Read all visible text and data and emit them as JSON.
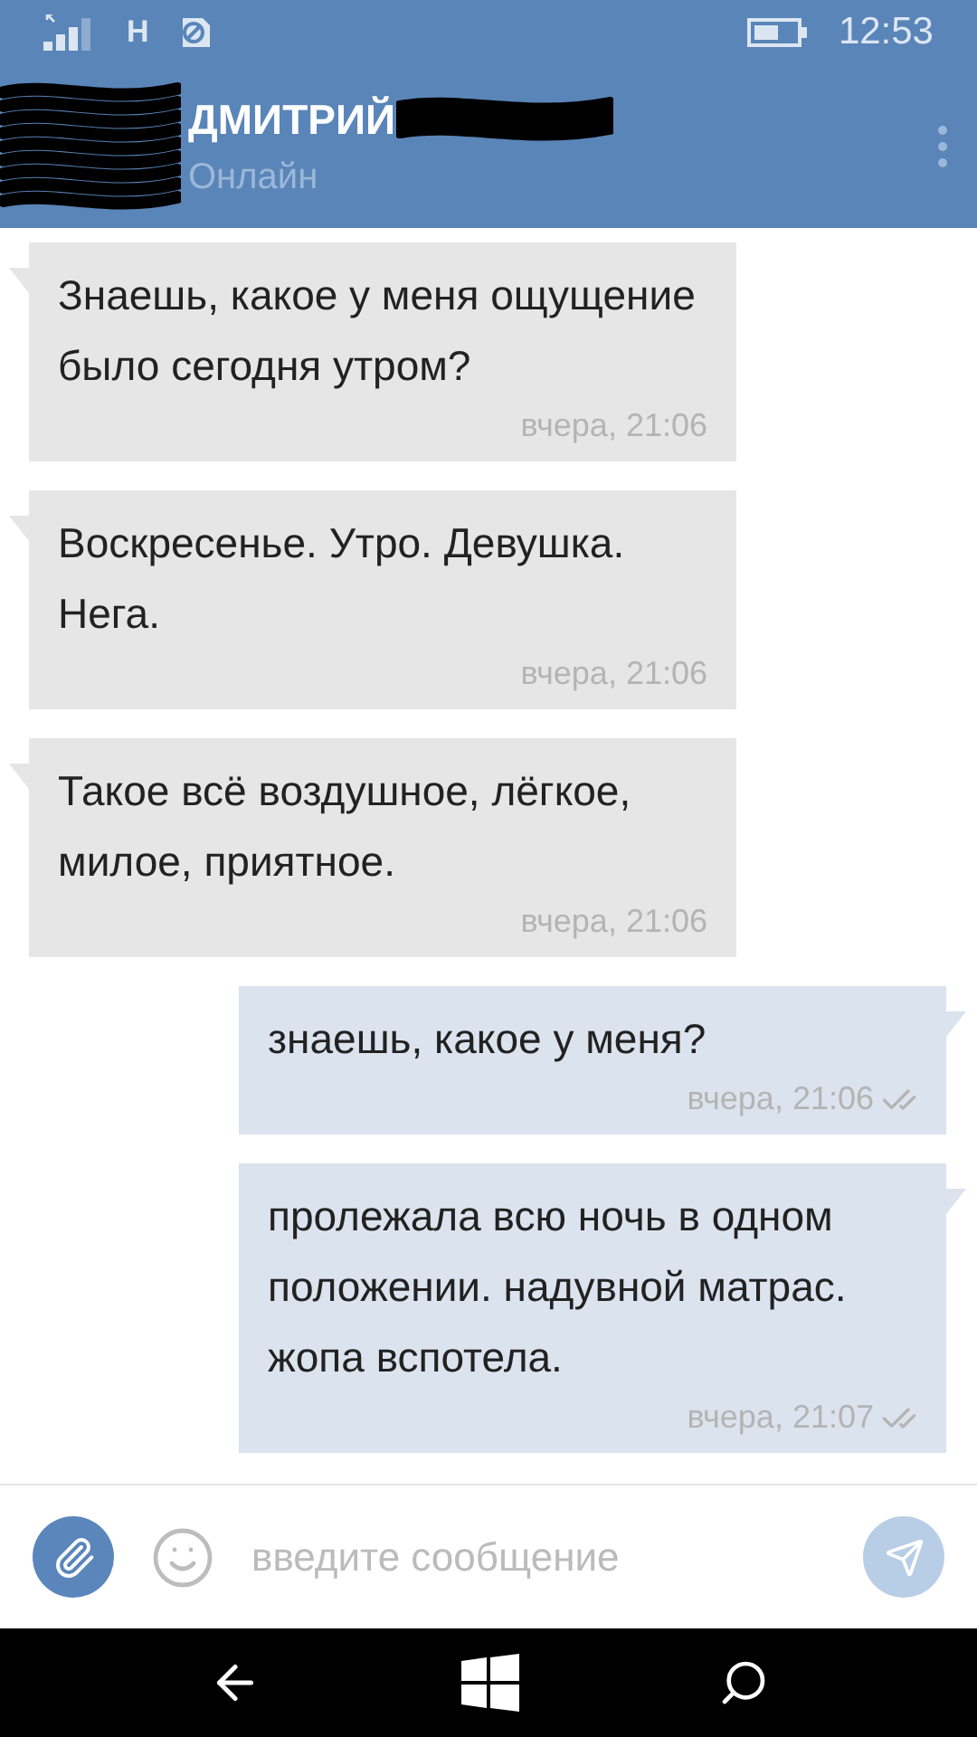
{
  "status_bar": {
    "network": "H",
    "time": "12:53"
  },
  "contact": {
    "name": "ДМИТРИЙ",
    "status": "Онлайн"
  },
  "messages": [
    {
      "kind": "incoming",
      "text": "Знаешь, какое у меня ощущение было сегодня утром?",
      "time": "вчера, 21:06"
    },
    {
      "kind": "incoming",
      "text": "Воскресенье. Утро. Девушка. Нега.",
      "time": "вчера, 21:06"
    },
    {
      "kind": "incoming",
      "text": "Такое всё воздушное, лёгкое, милое, приятное.",
      "time": "вчера, 21:06"
    },
    {
      "kind": "outgoing",
      "text": "знаешь, какое у меня?",
      "time": "вчера, 21:06",
      "read": true
    },
    {
      "kind": "outgoing",
      "text": "пролежала всю ночь в одном положении. надувной матрас. жопа вспотела.",
      "time": "вчера, 21:07",
      "read": true
    }
  ],
  "composer": {
    "placeholder": "введите сообщение"
  }
}
